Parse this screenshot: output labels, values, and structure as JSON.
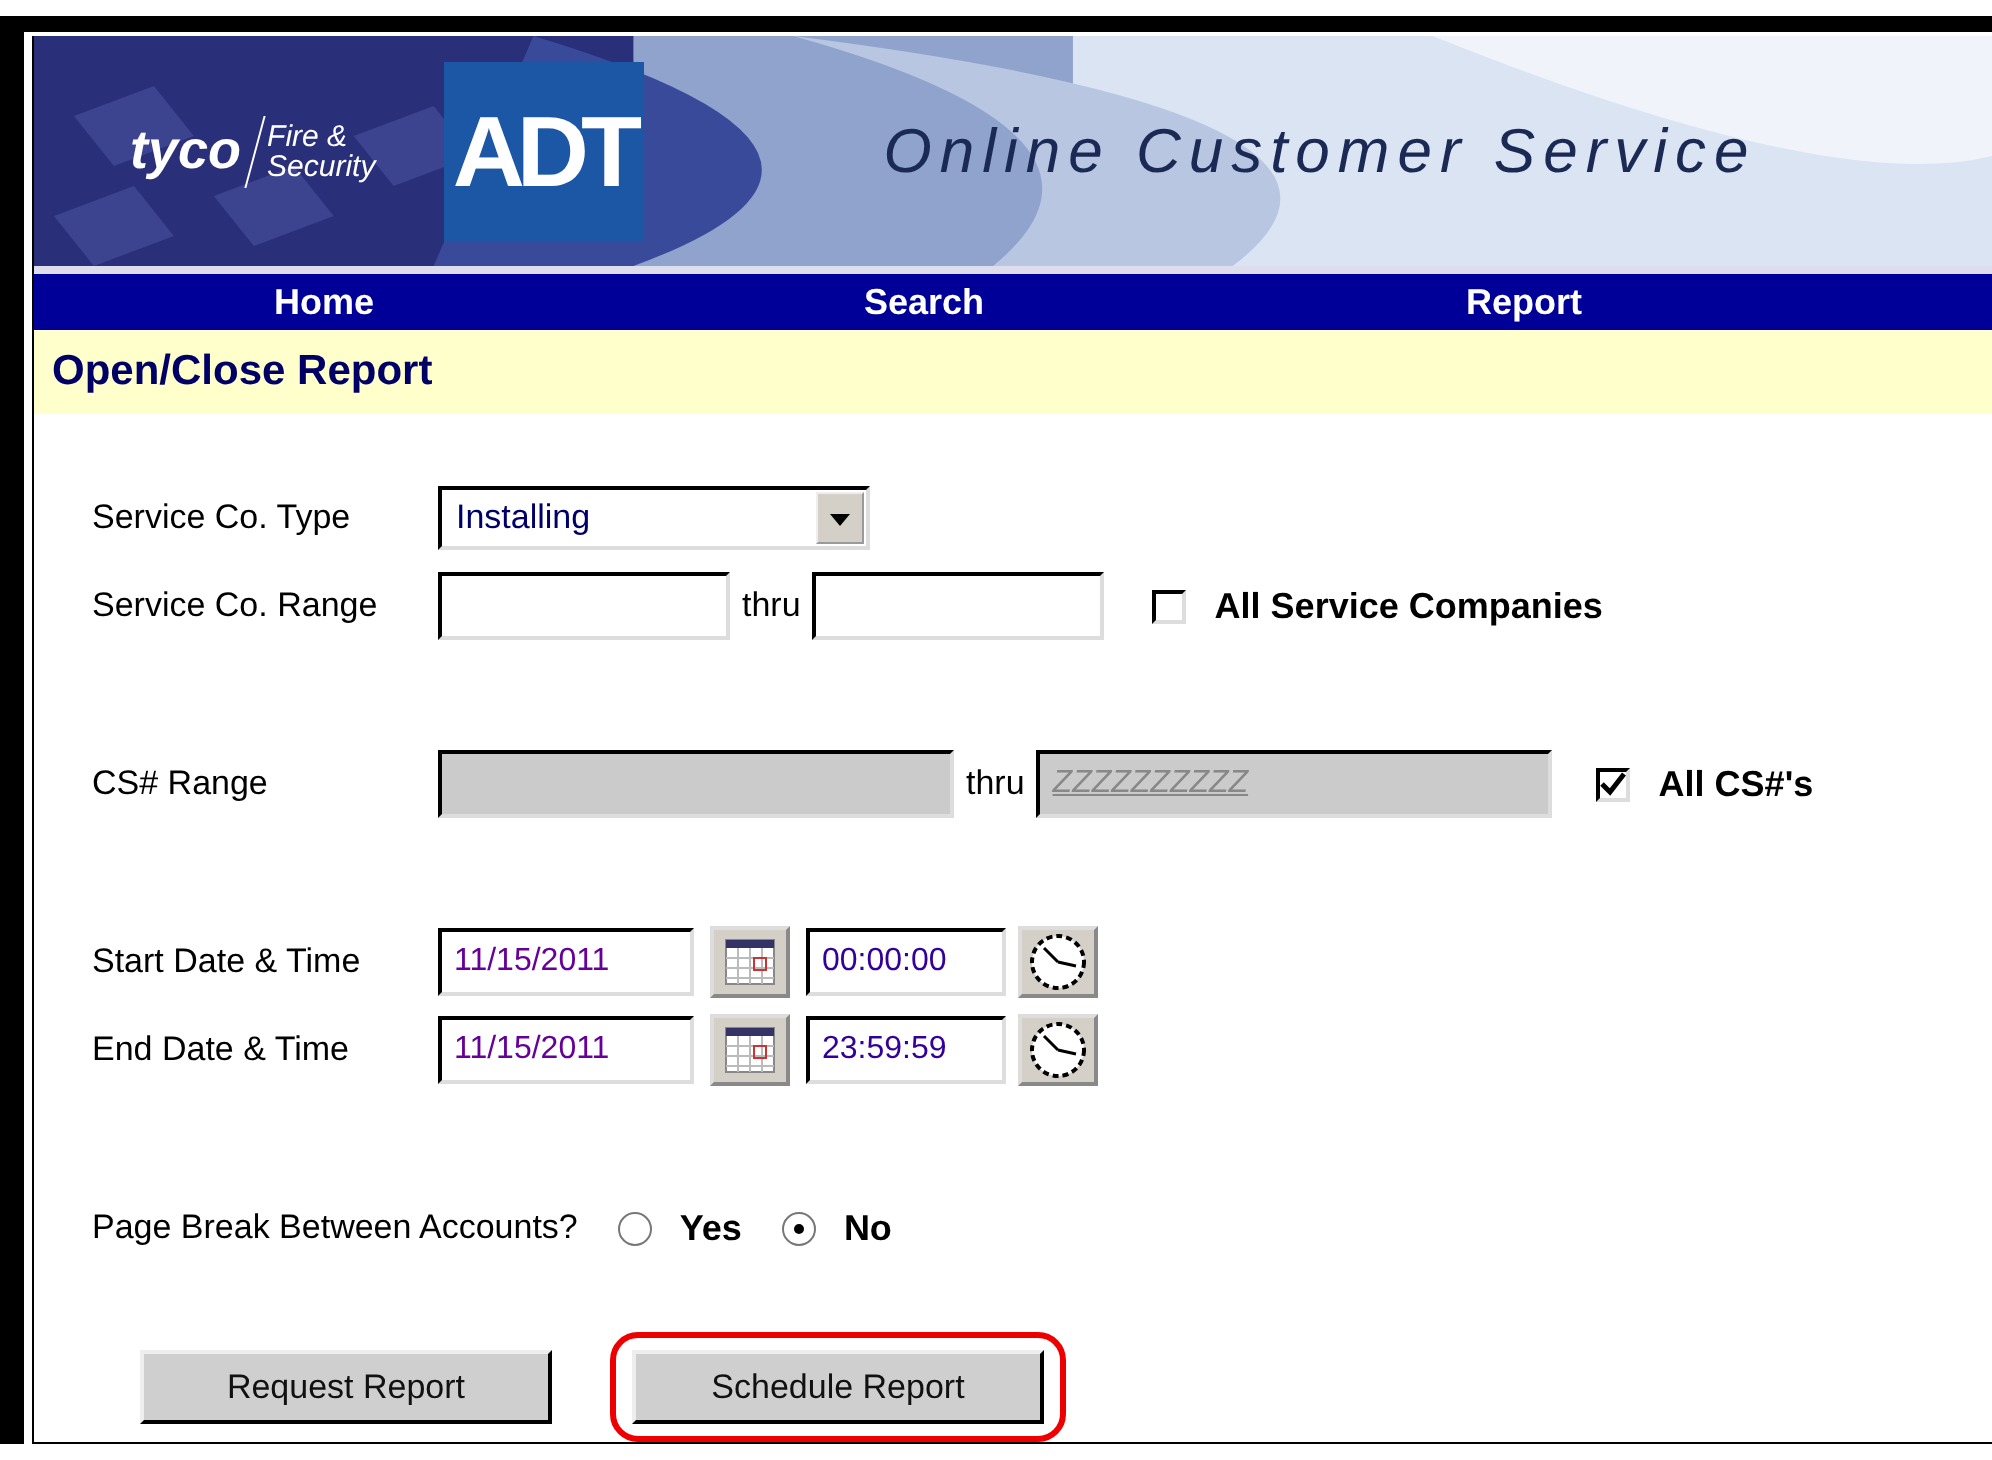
{
  "header": {
    "brand": "tyco",
    "division_line_1": "Fire &",
    "division_line_2": "Security",
    "logo": "ADT",
    "title": "Online Customer Service"
  },
  "nav": [
    {
      "label": "Home"
    },
    {
      "label": "Search"
    },
    {
      "label": "Report"
    }
  ],
  "page_title": "Open/Close Report",
  "service_co_type": {
    "label": "Service Co. Type",
    "value": "Installing"
  },
  "service_co_range": {
    "label": "Service Co. Range",
    "thru": "thru",
    "all": {
      "label": "All Service Companies",
      "checked": false
    }
  },
  "cs_range": {
    "label": "CS# Range",
    "disabled": true,
    "to_value": "ZZZZZZZZZZ",
    "thru": "thru",
    "all": {
      "label": "All CS#'s",
      "checked": true
    }
  },
  "dates": [
    {
      "label": "Start Date & Time",
      "date": "11/15/2011",
      "time": "00:00:00"
    },
    {
      "label": "End Date & Time",
      "date": "11/15/2011",
      "time": "23:59:59"
    }
  ],
  "page_break": {
    "label": "Page Break Between Accounts?",
    "options": [
      {
        "label": "Yes",
        "selected": false
      },
      {
        "label": "No",
        "selected": true
      }
    ]
  },
  "buttons": [
    {
      "label": "Request Report",
      "highlighted": false
    },
    {
      "label": "Schedule Report",
      "highlighted": true
    }
  ]
}
